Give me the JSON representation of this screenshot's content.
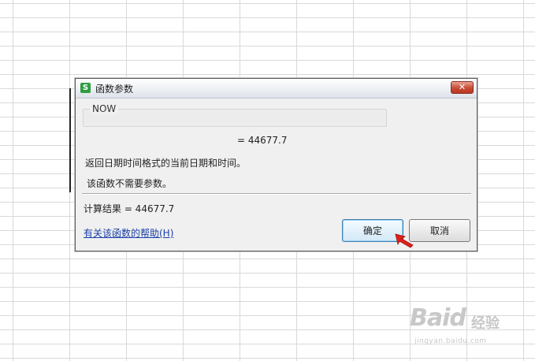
{
  "dialog": {
    "title": "函数参数",
    "app_icon_letter": "S",
    "close_symbol": "✕",
    "function_name": "NOW",
    "equals_text": "=  44677.7",
    "description": "返回日期时间格式的当前日期和时间。",
    "no_args_text": "该函数不需要参数。",
    "calc_result_label": "计算结果  =  44677.7",
    "help_link": "有关该函数的帮助(H)",
    "ok_label": "确定",
    "cancel_label": "取消"
  },
  "watermark": {
    "logo": "Baid",
    "text": "经验",
    "url": "jingyan.baidu.com"
  },
  "colors": {
    "close_button": "#c74b33",
    "link": "#1a3fa8",
    "pointer_arrow": "#e0201a",
    "app_icon": "#2e9d40"
  },
  "icons": {
    "app": "wps-spreadsheet-icon",
    "close": "close-icon",
    "pointer": "red-arrow-pointer-icon"
  }
}
